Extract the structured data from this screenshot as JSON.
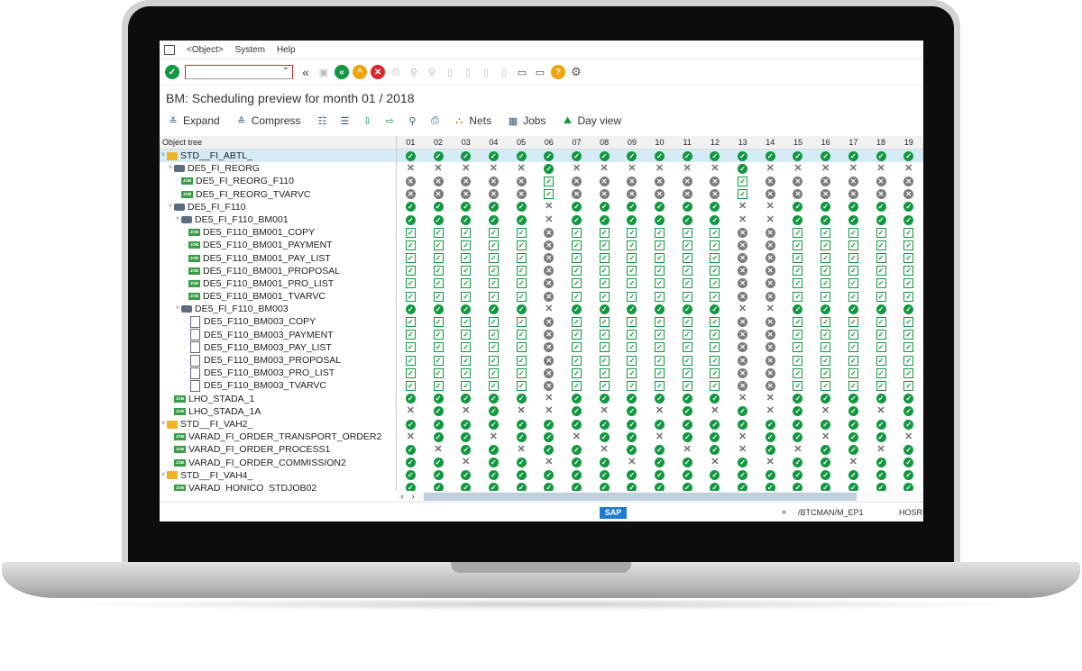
{
  "menu": {
    "items": [
      "<Object>",
      "System",
      "Help"
    ]
  },
  "toolbar": {
    "command_value": ""
  },
  "title": "BM: Scheduling preview for month 01 / 2018",
  "app_toolbar": {
    "expand": "Expand",
    "compress": "Compress",
    "nets": "Nets",
    "jobs": "Jobs",
    "day_view": "Day view"
  },
  "tree": {
    "header": "Object tree"
  },
  "days": [
    "01",
    "02",
    "03",
    "04",
    "05",
    "06",
    "07",
    "08",
    "09",
    "10",
    "11",
    "12",
    "13",
    "14",
    "15",
    "16",
    "17",
    "18",
    "19"
  ],
  "rows": [
    {
      "label": "STD__FI_ABTL_",
      "type": "folder",
      "indent": 0,
      "sel": true,
      "s": "OOOOOOOOOOOOOOOOOOO"
    },
    {
      "label": "DE5_FI_REORG",
      "type": "node",
      "indent": 1,
      "s": "XXXXXOXXXXXXOXXXXXX"
    },
    {
      "label": "DE5_FI_REORG_F110",
      "type": "job",
      "indent": 2,
      "s": "NNNNNCNNNNNNCNNNNNN"
    },
    {
      "label": "DE5_FI_REORG_TVARVC",
      "type": "job",
      "indent": 2,
      "s": "NNNNNCNNNNNNCNNNNNN"
    },
    {
      "label": "DE5_FI_F110",
      "type": "node",
      "indent": 1,
      "s": "OOOOOXOOOOOOXXOOOOO"
    },
    {
      "label": "DE5_FI_F110_BM001",
      "type": "node",
      "indent": 2,
      "s": "OOOOOXOOOOOOXXOOOOO"
    },
    {
      "label": "DE5_F110_BM001_COPY",
      "type": "job",
      "indent": 3,
      "s": "CCCCCNCCCCCCNNCCCCC"
    },
    {
      "label": "DE5_F110_BM001_PAYMENT",
      "type": "job",
      "indent": 3,
      "s": "CCCCCNCCCCCCNNCCCCC"
    },
    {
      "label": "DE5_F110_BM001_PAY_LIST",
      "type": "job",
      "indent": 3,
      "s": "CCCCCNCCCCCCNNCCCCC"
    },
    {
      "label": "DE5_F110_BM001_PROPOSAL",
      "type": "job",
      "indent": 3,
      "s": "CCCCCNCCCCCCNNCCCCC"
    },
    {
      "label": "DE5_F110_BM001_PRO_LIST",
      "type": "job",
      "indent": 3,
      "s": "CCCCCNCCCCCCNNCCCCC"
    },
    {
      "label": "DE5_F110_BM001_TVARVC",
      "type": "job",
      "indent": 3,
      "s": "CCCCCNCCCCCCNNCCCCC"
    },
    {
      "label": "DE5_FI_F110_BM003",
      "type": "node",
      "indent": 2,
      "s": "OOOOOXOOOOOOXXOOOOO"
    },
    {
      "label": "DE5_F110_BM003_COPY",
      "type": "doc",
      "indent": 3,
      "s": "CCCCCNCCCCCCNNCCCCC"
    },
    {
      "label": "DE5_F110_BM003_PAYMENT",
      "type": "doc",
      "indent": 3,
      "s": "CCCCCNCCCCCCNNCCCCC"
    },
    {
      "label": "DE5_F110_BM003_PAY_LIST",
      "type": "doc",
      "indent": 3,
      "s": "CCCCCNCCCCCCNNCCCCC"
    },
    {
      "label": "DE5_F110_BM003_PROPOSAL",
      "type": "doc",
      "indent": 3,
      "s": "CCCCCNCCCCCCNNCCCCC"
    },
    {
      "label": "DE5_F110_BM003_PRO_LIST",
      "type": "doc",
      "indent": 3,
      "s": "CCCCCNCCCCCCNNCCCCC"
    },
    {
      "label": "DE5_F110_BM003_TVARVC",
      "type": "doc",
      "indent": 3,
      "s": "CCCCCNCCCCCCNNCCCCC"
    },
    {
      "label": "LHO_STADA_1",
      "type": "job",
      "indent": 1,
      "s": "OOOOOXOOOOOOXXOOOOO"
    },
    {
      "label": "LHO_STADA_1A",
      "type": "job",
      "indent": 1,
      "s": "XOXOXXOXOXOXOXOXOXO"
    },
    {
      "label": "STD__FI_VAH2_",
      "type": "folder",
      "indent": 0,
      "s": "OOOOOOOOOOOOOOOOOOO"
    },
    {
      "label": "VARAD_FI_ORDER_TRANSPORT_ORDER2",
      "type": "job",
      "indent": 1,
      "s": "XOOXOOXOOXOOXOOXOOX"
    },
    {
      "label": "VARAD_FI_ORDER_PROCESS1",
      "type": "job",
      "indent": 1,
      "s": "OXOOXOOXOOXOXOXOOXO"
    },
    {
      "label": "VARAD_FI_ORDER_COMMISSION2",
      "type": "job",
      "indent": 1,
      "s": "OOXOOXOOXOOXOXOOXOO"
    },
    {
      "label": "STD__FI_VAH4_",
      "type": "folder",
      "indent": 0,
      "s": "OOOOOOOOOOOOOOOOOOO"
    },
    {
      "label": "VARAD_HONICO_STDJOB02",
      "type": "job",
      "indent": 1,
      "s": "OOOOOOOOOOOOOOOOOOO"
    }
  ],
  "status": {
    "logo": "SAP",
    "system": "/BTCMAN/M_EP1",
    "host": "HOSRI"
  },
  "colors": {
    "ok_green": "#129740",
    "gray": "#7a7a7a",
    "selection": "#d5ebf5"
  }
}
